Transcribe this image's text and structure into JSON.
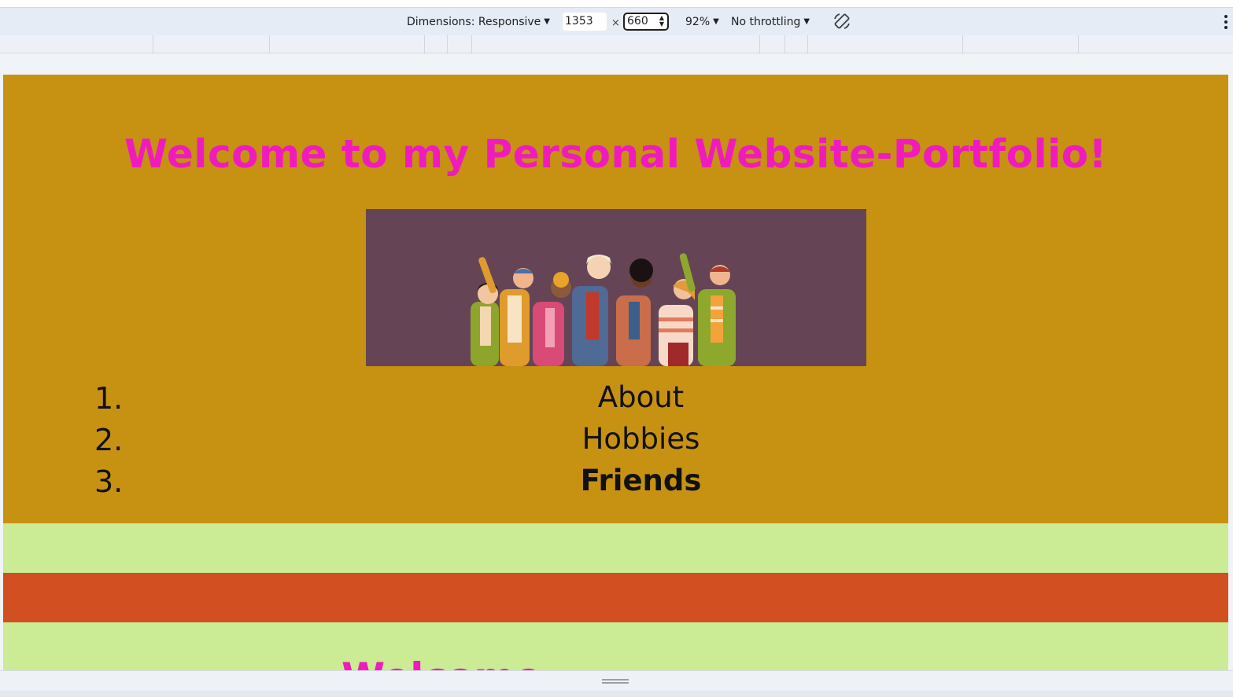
{
  "toolbar": {
    "dimensions_label": "Dimensions: Responsive",
    "width_value": "1353",
    "times": "×",
    "height_value": "660",
    "zoom_label": "92%",
    "throttling_label": "No throttling",
    "rotate_icon": "rotate-icon",
    "more_icon": "more-vert-icon"
  },
  "page": {
    "title": "Welcome to my Personal Website-Portfolio!",
    "nav": [
      {
        "number": "1.",
        "label": "About"
      },
      {
        "number": "2.",
        "label": "Hobbies"
      },
      {
        "number": "3.",
        "label": "Friends"
      }
    ],
    "partial_heading": "Welcome",
    "colors": {
      "hero_bg": "#c79112",
      "title": "#f01bbd",
      "green_band": "#cbec95",
      "orange_band": "#d24f22",
      "image_bg": "#654555"
    }
  }
}
